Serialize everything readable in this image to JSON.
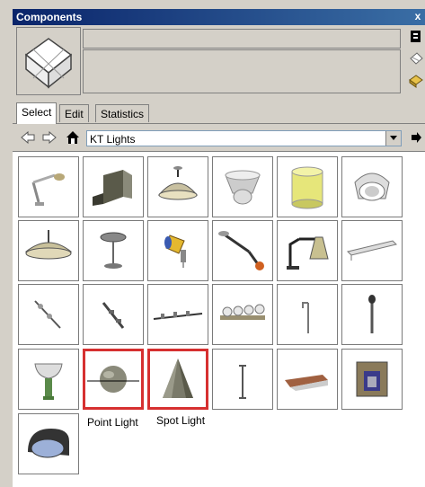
{
  "window": {
    "title": "Components",
    "close_label": "x"
  },
  "tabs": [
    {
      "label": "Select",
      "active": true
    },
    {
      "label": "Edit",
      "active": false
    },
    {
      "label": "Statistics",
      "active": false
    }
  ],
  "toolbar": {
    "back_icon": "back-arrow-icon",
    "forward_icon": "forward-arrow-icon",
    "home_icon": "home-icon",
    "collection_value": "KT Lights",
    "details_icon": "details-arrow-icon"
  },
  "highlight_color": "#d63030",
  "components": [
    {
      "name": "desk-lamp-angled",
      "caption": ""
    },
    {
      "name": "wall-box-light",
      "caption": ""
    },
    {
      "name": "hanging-dome-light",
      "caption": ""
    },
    {
      "name": "hanging-pendant-light",
      "caption": ""
    },
    {
      "name": "cylinder-light",
      "caption": ""
    },
    {
      "name": "recessed-light",
      "caption": ""
    },
    {
      "name": "dish-pendant-light",
      "caption": ""
    },
    {
      "name": "table-lamp",
      "caption": ""
    },
    {
      "name": "spotlight-yellow",
      "caption": ""
    },
    {
      "name": "desk-lamp-arm",
      "caption": ""
    },
    {
      "name": "desk-lamp-cone",
      "caption": ""
    },
    {
      "name": "linear-fixture",
      "caption": ""
    },
    {
      "name": "track-light-diagonal",
      "caption": ""
    },
    {
      "name": "track-light-short",
      "caption": ""
    },
    {
      "name": "track-light-bar",
      "caption": ""
    },
    {
      "name": "vanity-light-bar",
      "caption": ""
    },
    {
      "name": "street-lamp-hook",
      "caption": ""
    },
    {
      "name": "pole-light",
      "caption": ""
    },
    {
      "name": "torch-light",
      "caption": ""
    },
    {
      "name": "point-light",
      "caption": "Point Light",
      "selected": true
    },
    {
      "name": "spot-light",
      "caption": "Spot Light",
      "selected": true
    },
    {
      "name": "floor-pole",
      "caption": ""
    },
    {
      "name": "wall-sconce",
      "caption": ""
    },
    {
      "name": "box-fixture",
      "caption": ""
    },
    {
      "name": "half-dome-light",
      "caption": ""
    }
  ]
}
